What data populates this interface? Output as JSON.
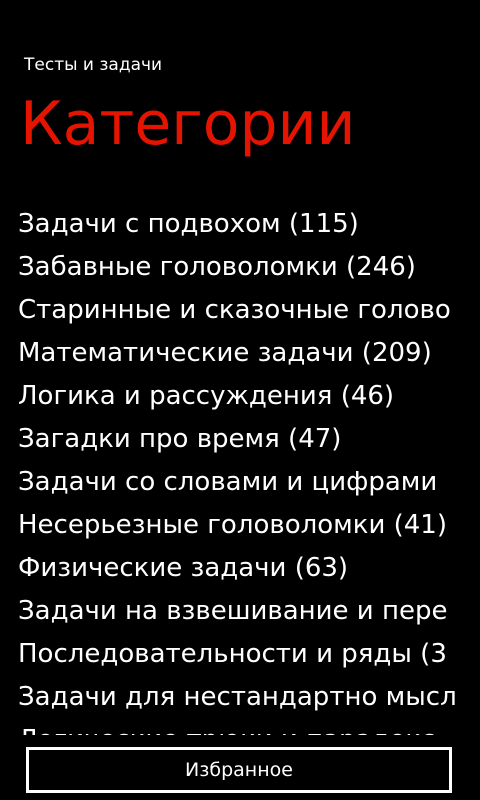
{
  "app": {
    "title": "Тесты и задачи"
  },
  "page": {
    "title": "Категории"
  },
  "categories": [
    "Задачи с подвохом (115)",
    "Забавные головоломки (246)",
    "Старинные и сказочные голово",
    "Математические задачи (209)",
    "Логика и рассуждения (46)",
    "Загадки про время (47)",
    "Задачи со словами и цифрами",
    "Несерьезные головоломки (41)",
    "Физические задачи (63)",
    "Задачи на взвешивание и пере",
    "Последовательности и ряды (3",
    "Задачи для нестандартно мысл",
    "Логические трюки и парадокс"
  ],
  "footer": {
    "favorites_label": "Избранное"
  },
  "colors": {
    "accent": "#e51400",
    "background": "#000000",
    "text": "#ffffff"
  }
}
